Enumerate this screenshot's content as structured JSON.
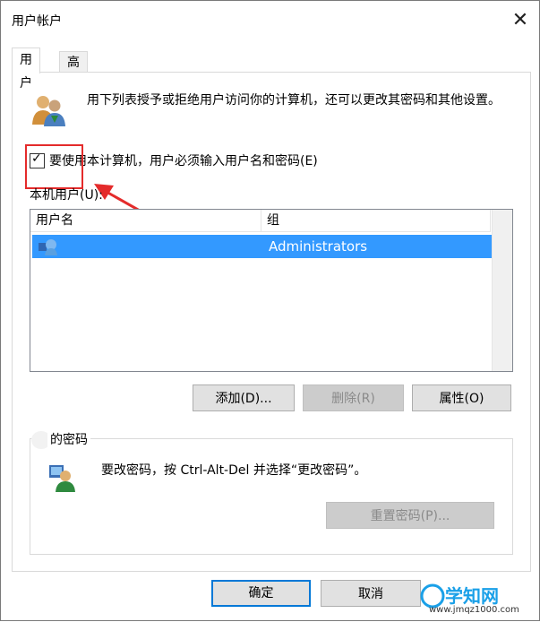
{
  "window": {
    "title": "用户帐户"
  },
  "tabs": [
    {
      "label": "用户"
    },
    {
      "label": "高级"
    }
  ],
  "intro_text": "用下列表授予或拒绝用户访问你的计算机，还可以更改其密码和其他设置。",
  "require_login": {
    "label": "要使用本计算机，用户必须输入用户名和密码(E)",
    "checked": true
  },
  "local_users": {
    "label": "本机用户(U):",
    "columns": [
      "用户名",
      "组"
    ],
    "rows": [
      {
        "name": "",
        "group": "Administrators",
        "selected": true
      }
    ]
  },
  "buttons": {
    "add": "添加(D)...",
    "remove": "删除(R)",
    "properties": "属性(O)"
  },
  "password_group": {
    "title": "的密码",
    "text": "要改密码，按 Ctrl-Alt-Del 并选择“更改密码”。",
    "reset_button": "重置密码(P)..."
  },
  "footer": {
    "ok": "确定",
    "cancel": "取消"
  },
  "watermark": {
    "logo": "学知网",
    "url": "www.jmqz1000.com"
  },
  "colors": {
    "selection": "#3399ff",
    "annotation": "#e42b2b"
  }
}
